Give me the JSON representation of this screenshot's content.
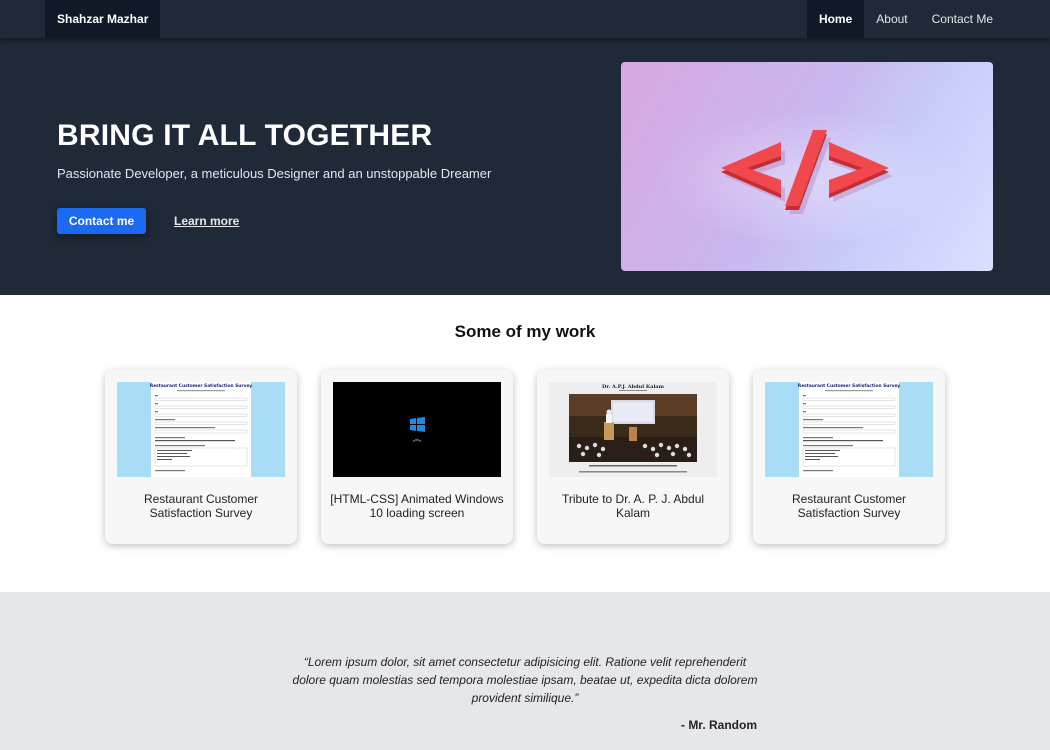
{
  "navbar": {
    "brand": "Shahzar Mazhar",
    "links": [
      {
        "label": "Home",
        "active": true
      },
      {
        "label": "About",
        "active": false
      },
      {
        "label": "Contact Me",
        "active": false
      }
    ]
  },
  "hero": {
    "title": "BRING IT ALL TOGETHER",
    "subtitle": "Passionate Developer, a meticulous Designer and an unstoppable Dreamer",
    "primary_button": "Contact me",
    "secondary_link": "Learn more",
    "image_icon": "code-brackets-icon",
    "image_symbol": "</>",
    "accent_color": "#1d6af2",
    "background_color": "#1f2937"
  },
  "work": {
    "title": "Some of my work",
    "cards": [
      {
        "label": "Restaurant Customer Satisfaction Survey",
        "thumb": "survey"
      },
      {
        "label": "[HTML-CSS] Animated Windows 10 loading screen",
        "thumb": "windows"
      },
      {
        "label": "Tribute to Dr. A. P. J. Abdul Kalam",
        "thumb": "tribute"
      },
      {
        "label": "Restaurant Customer Satisfaction Survey",
        "thumb": "survey"
      }
    ],
    "thumbnails": {
      "survey_title": "Restaurant Customer Satisfaction Survey",
      "tribute_title": "Dr. A.P.J. Abdul Kalam"
    }
  },
  "testimonial": {
    "quote": "“Lorem ipsum dolor, sit amet consectetur adipisicing elit. Ratione velit reprehenderit dolore quam molestias sed tempora molestiae ipsam, beatae ut, expedita dicta dolorem provident similique.”",
    "author": "- Mr. Random"
  }
}
